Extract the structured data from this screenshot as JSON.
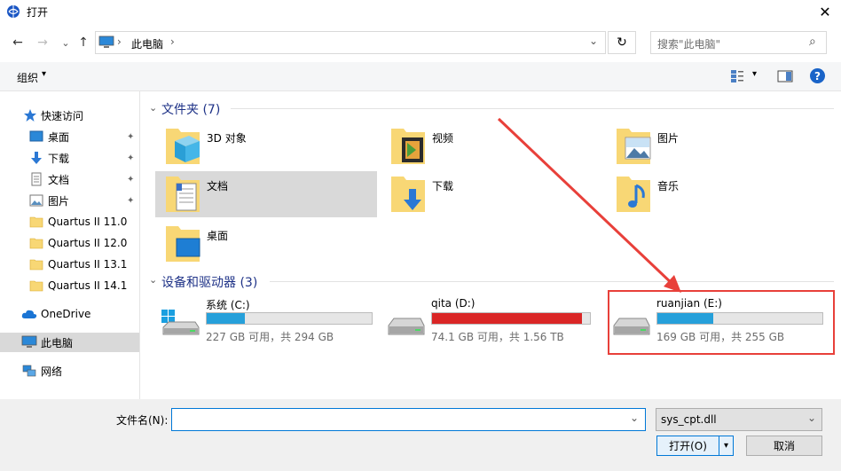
{
  "window": {
    "title": "打开",
    "close_label": "✕"
  },
  "nav": {
    "back": "←",
    "forward": "→",
    "recent": "⌄",
    "up": "↑"
  },
  "address": {
    "breadcrumb": [
      "此电脑"
    ],
    "sep": "›",
    "dropdown": "⌄",
    "refresh": "↻"
  },
  "search": {
    "placeholder": "搜索\"此电脑\"",
    "icon": "⌕"
  },
  "toolbar": {
    "organize": "组织",
    "organize_arrow": "▾",
    "view_arrow": "▾",
    "help": "?"
  },
  "sidebar": {
    "quick_access": "快速访问",
    "items": [
      {
        "label": "桌面",
        "pinned": true
      },
      {
        "label": "下载",
        "pinned": true
      },
      {
        "label": "文档",
        "pinned": true
      },
      {
        "label": "图片",
        "pinned": true
      },
      {
        "label": "Quartus II 11.0"
      },
      {
        "label": "Quartus II 12.0"
      },
      {
        "label": "Quartus II 13.1"
      },
      {
        "label": "Quartus II 14.1"
      }
    ],
    "onedrive": "OneDrive",
    "this_pc": "此电脑",
    "network": "网络",
    "pin_glyph": "📌"
  },
  "main": {
    "folders_header": "文件夹 (7)",
    "folders": [
      {
        "label": "3D 对象",
        "icon": "3d-objects-icon"
      },
      {
        "label": "视频",
        "icon": "video-icon"
      },
      {
        "label": "图片",
        "icon": "pictures-icon"
      },
      {
        "label": "文档",
        "icon": "documents-icon"
      },
      {
        "label": "下载",
        "icon": "downloads-icon"
      },
      {
        "label": "音乐",
        "icon": "music-icon"
      },
      {
        "label": "桌面",
        "icon": "desktop-icon"
      }
    ],
    "drives_header": "设备和驱动器 (3)",
    "drives": [
      {
        "name": "系统 (C:)",
        "free": "227 GB 可用，共 294 GB",
        "used_fraction": 0.23,
        "color": "#26a0da"
      },
      {
        "name": "qita (D:)",
        "free": "74.1 GB 可用，共 1.56 TB",
        "used_fraction": 0.95,
        "color": "#da2626"
      },
      {
        "name": "ruanjian (E:)",
        "free": "169 GB 可用，共 255 GB",
        "used_fraction": 0.34,
        "color": "#26a0da"
      }
    ],
    "collapse_glyph": "⌄"
  },
  "bottom": {
    "filename_label": "文件名(N):",
    "filename_value": "",
    "filter_value": "sys_cpt.dll",
    "open_label": "打开(O)",
    "open_arrow": "▾",
    "cancel_label": "取消",
    "dropdown": "⌄"
  },
  "colors": {
    "highlight": "#e8403a",
    "selected_bg": "#d9d9d9",
    "header_blue": "#1e3287"
  }
}
